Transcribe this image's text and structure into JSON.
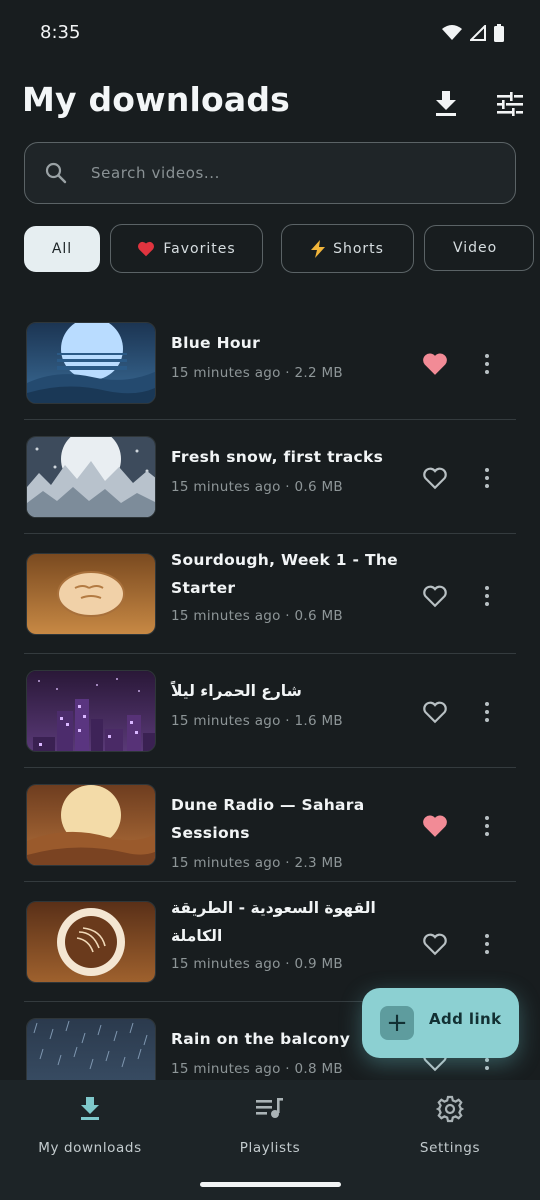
{
  "status_bar": {
    "time": "8:35"
  },
  "header": {
    "title": "My downloads"
  },
  "search": {
    "placeholder": "Search videos..."
  },
  "chips": [
    {
      "label": "All",
      "active": true
    },
    {
      "label": "Favorites",
      "icon": "heart-icon"
    },
    {
      "label": "Shorts",
      "icon": "lightning-icon"
    },
    {
      "label": "Video"
    }
  ],
  "videos": [
    {
      "title": "Blue Hour",
      "meta": "15 minutes ago · 2.2 MB",
      "favorite": true
    },
    {
      "title": "Fresh snow, first tracks",
      "meta": "15 minutes ago · 0.6 MB",
      "favorite": false
    },
    {
      "title": "Sourdough, Week 1 - The Starter",
      "meta": "15 minutes ago · 0.6 MB",
      "favorite": false
    },
    {
      "title": "شارع الحمراء ليلاً",
      "meta": "15 minutes ago · 1.6 MB",
      "favorite": false
    },
    {
      "title": "Dune Radio — Sahara Sessions",
      "meta": "15 minutes ago · 2.3 MB",
      "favorite": true
    },
    {
      "title": "القهوة السعودية - الطريقة الكاملة",
      "meta": "15 minutes ago · 0.9 MB",
      "favorite": false
    },
    {
      "title": "Rain on the balcony",
      "meta": "15 minutes ago · 0.8 MB",
      "favorite": false
    }
  ],
  "fab": {
    "label": "Add link"
  },
  "bottom_nav": [
    {
      "label": "My downloads",
      "icon": "download-icon",
      "active": true
    },
    {
      "label": "Playlists",
      "icon": "playlist-icon"
    },
    {
      "label": "Settings",
      "icon": "gear-icon"
    }
  ],
  "colors": {
    "background": "#181d1f",
    "accent": "#8cd0d2",
    "favorite": "#f28b96"
  }
}
